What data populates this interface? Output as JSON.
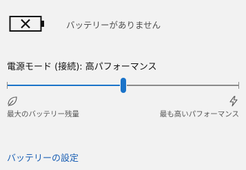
{
  "battery": {
    "icon": "battery-missing-icon",
    "status_text": "バッテリーがありません"
  },
  "power_mode": {
    "label": "電源モード (接続): 高パフォーマンス",
    "slider_level": 0.5,
    "min_label": "最大のバッテリー残量",
    "max_label": "最も高いパフォーマンス",
    "min_icon": "leaf-icon",
    "max_icon": "lightning-icon"
  },
  "link": {
    "settings_label": "バッテリーの設定"
  },
  "colors": {
    "accent": "#1a73c9",
    "link": "#1a5fb4",
    "background": "#f2f2f2"
  }
}
